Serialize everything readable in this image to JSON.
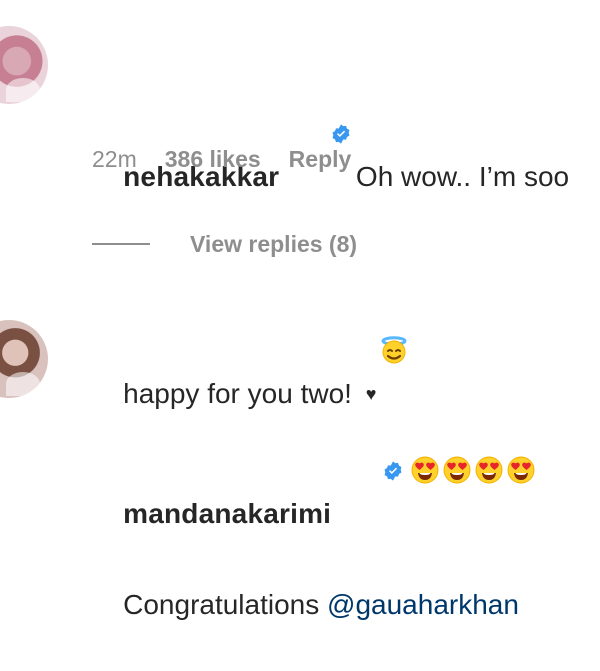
{
  "comments": [
    {
      "username": "nehakakkar",
      "text_line1": "Oh wow.. I’m soo",
      "text_line2": "happy for you two! ",
      "heart": "♥",
      "emoji": "smiling-face-with-halo",
      "time": "22m",
      "likes": "386 likes",
      "reply_label": "Reply",
      "view_replies": "View replies (8)"
    },
    {
      "username": "mandanakarimi",
      "emoji_count": 4,
      "emoji": "smiling-face-with-heart-eyes",
      "text": "Congratulations ",
      "mention": "@gauaharkhan"
    }
  ],
  "colors": {
    "verified_blue": "#3897f0",
    "secondary_text": "#8e8e8e",
    "mention": "#00376b"
  }
}
